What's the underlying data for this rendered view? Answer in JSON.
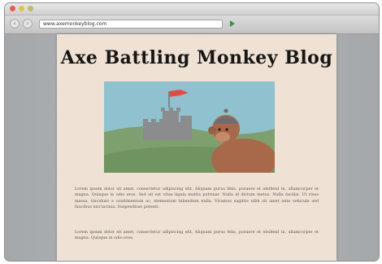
{
  "browser": {
    "url": "www.axemonkeyblog.com"
  },
  "blog": {
    "title": "Axe Battling Monkey Blog",
    "paragraphs": [
      "Lorem ipsum dolor sit amet, consectetur adipiscing elit. Aliquam purus felis, posuere et eleifend in, ullamcorper et magna. Quisque in odio eros. Sed sit est vitae ligula mattis pulvinar. Nulla id dictum metus. Nulla facilisi. Ut risus massa, tincidunt a condimentum ac, elementum bibendum nulla. Vivamus sagittis nibh sit amet ante vehicula sed faucibus nisi lacinia. Suspendisse potenti.",
      "Lorem ipsum dolor sit amet, consectetur adipiscing elit. Aliquam purus felis, posuere et eleifend in, ullamcorper et magna. Quisque in odio eros."
    ]
  },
  "colors": {
    "sky": "#8fc1cf",
    "hill": "#7ea06e",
    "flag": "#e8493f",
    "castle": "#8a8c8d",
    "monkey": "#a8694a",
    "paper": "#efe1d3"
  }
}
